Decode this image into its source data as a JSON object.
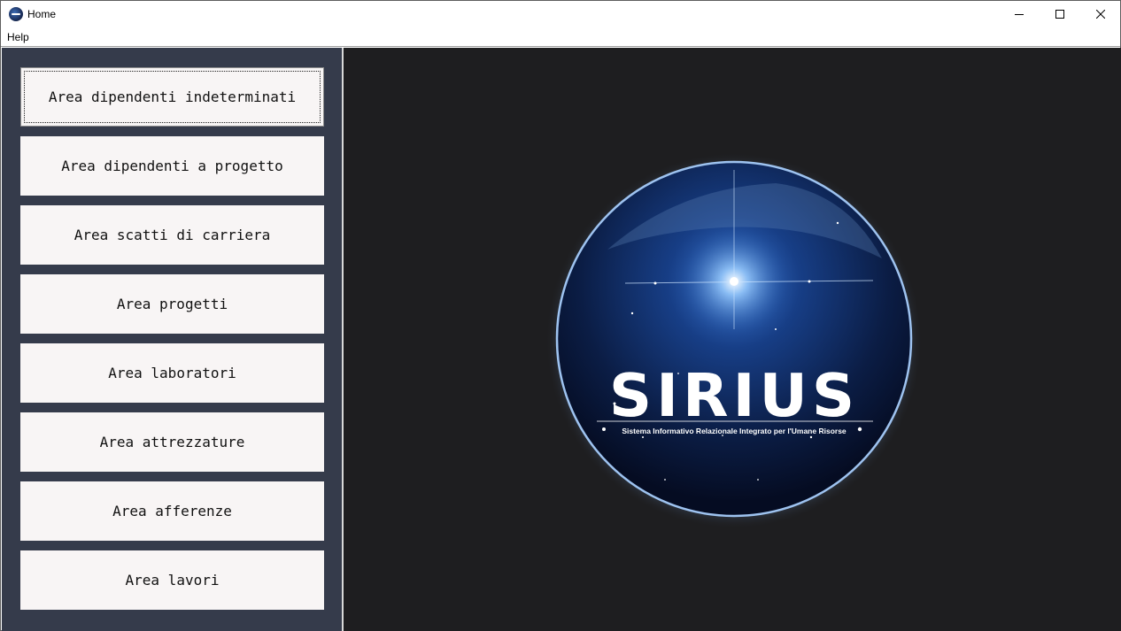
{
  "window": {
    "title": "Home"
  },
  "menu": {
    "items": [
      "Help"
    ]
  },
  "sidebar": {
    "buttons": [
      "Area dipendenti indeterminati",
      "Area dipendenti a progetto",
      "Area scatti di carriera",
      "Area progetti",
      "Area laboratori",
      "Area attrezzature",
      "Area afferenze",
      "Area lavori"
    ]
  },
  "logo": {
    "name": "SIRIUS",
    "tagline": "Sistema Informativo Relazionale Integrato per l'Umane Risorse"
  },
  "colors": {
    "sidebar_bg": "#353b4b",
    "main_bg": "#1e1e20",
    "button_bg": "#f8f5f5",
    "globe_blue": "#1c4fa0"
  },
  "icons": {
    "app": "sirius-globe-icon",
    "minimize": "minimize-icon",
    "maximize": "maximize-icon",
    "close": "close-icon"
  }
}
